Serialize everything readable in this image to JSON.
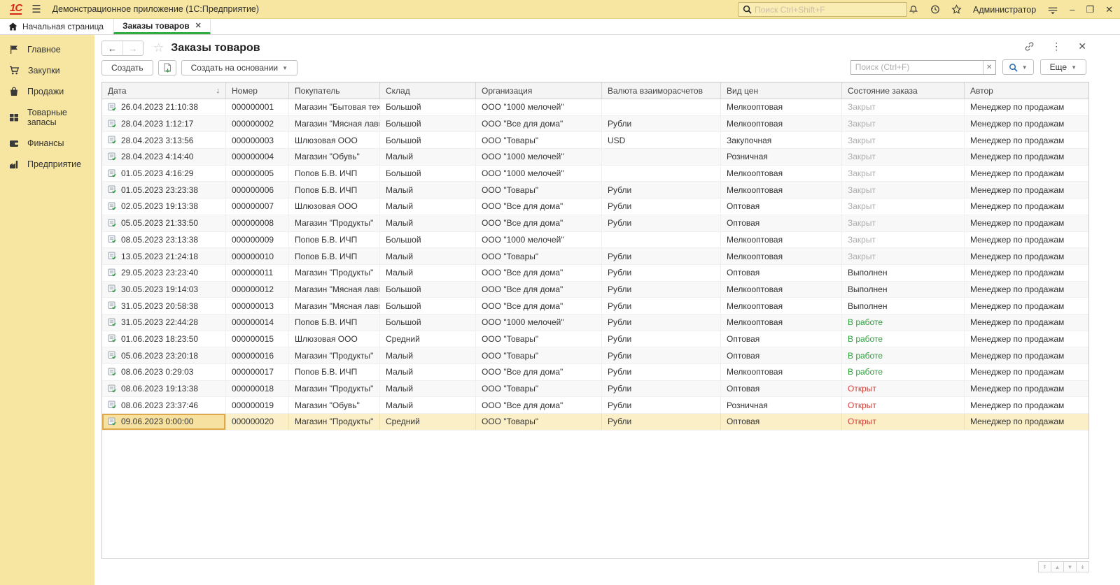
{
  "titlebar": {
    "app_title": "Демонстрационное приложение  (1С:Предприятие)",
    "logo": "1С",
    "search_placeholder": "Поиск Ctrl+Shift+F",
    "user": "Администратор"
  },
  "tabs": {
    "home_label": "Начальная страница",
    "active_tab_label": "Заказы товаров"
  },
  "sidebar": {
    "items": [
      {
        "label": "Главное",
        "icon": "flag-icon"
      },
      {
        "label": "Закупки",
        "icon": "cart-icon"
      },
      {
        "label": "Продажи",
        "icon": "bag-icon"
      },
      {
        "label": "Товарные запасы",
        "icon": "grid-icon"
      },
      {
        "label": "Финансы",
        "icon": "wallet-icon"
      },
      {
        "label": "Предприятие",
        "icon": "factory-icon"
      }
    ]
  },
  "page": {
    "title": "Заказы товаров",
    "toolbar": {
      "create_label": "Создать",
      "create_based_label": "Создать на основании",
      "search_placeholder": "Поиск (Ctrl+F)",
      "more_label": "Еще"
    }
  },
  "table": {
    "columns": [
      "Дата",
      "Номер",
      "Покупатель",
      "Склад",
      "Организация",
      "Валюта взаиморасчетов",
      "Вид цен",
      "Состояние заказа",
      "Автор"
    ],
    "sort_column": "Дата",
    "sort_direction": "asc",
    "selected_row_index": 19,
    "rows": [
      {
        "date": "26.04.2023 21:10:38",
        "number": "000000001",
        "customer": "Магазин \"Бытовая тех...",
        "warehouse": "Большой",
        "org": "ООО \"1000 мелочей\"",
        "currency": "",
        "price_type": "Мелкооптовая",
        "status": "Закрыт",
        "status_state": "closed",
        "author": "Менеджер по продажам"
      },
      {
        "date": "28.04.2023 1:12:17",
        "number": "000000002",
        "customer": "Магазин \"Мясная лавка\"",
        "warehouse": "Большой",
        "org": "ООО \"Все для дома\"",
        "currency": "Рубли",
        "price_type": "Мелкооптовая",
        "status": "Закрыт",
        "status_state": "closed",
        "author": "Менеджер по продажам"
      },
      {
        "date": "28.04.2023 3:13:56",
        "number": "000000003",
        "customer": "Шлюзовая ООО",
        "warehouse": "Большой",
        "org": "ООО \"Товары\"",
        "currency": "USD",
        "price_type": "Закупочная",
        "status": "Закрыт",
        "status_state": "closed",
        "author": "Менеджер по продажам"
      },
      {
        "date": "28.04.2023 4:14:40",
        "number": "000000004",
        "customer": "Магазин \"Обувь\"",
        "warehouse": "Малый",
        "org": "ООО \"1000 мелочей\"",
        "currency": "",
        "price_type": "Розничная",
        "status": "Закрыт",
        "status_state": "closed",
        "author": "Менеджер по продажам"
      },
      {
        "date": "01.05.2023 4:16:29",
        "number": "000000005",
        "customer": "Попов Б.В. ИЧП",
        "warehouse": "Большой",
        "org": "ООО \"1000 мелочей\"",
        "currency": "",
        "price_type": "Мелкооптовая",
        "status": "Закрыт",
        "status_state": "closed",
        "author": "Менеджер по продажам"
      },
      {
        "date": "01.05.2023 23:23:38",
        "number": "000000006",
        "customer": "Попов Б.В. ИЧП",
        "warehouse": "Малый",
        "org": "ООО \"Товары\"",
        "currency": "Рубли",
        "price_type": "Мелкооптовая",
        "status": "Закрыт",
        "status_state": "closed",
        "author": "Менеджер по продажам"
      },
      {
        "date": "02.05.2023 19:13:38",
        "number": "000000007",
        "customer": "Шлюзовая ООО",
        "warehouse": "Малый",
        "org": "ООО \"Все для дома\"",
        "currency": "Рубли",
        "price_type": "Оптовая",
        "status": "Закрыт",
        "status_state": "closed",
        "author": "Менеджер по продажам"
      },
      {
        "date": "05.05.2023 21:33:50",
        "number": "000000008",
        "customer": "Магазин \"Продукты\"",
        "warehouse": "Малый",
        "org": "ООО \"Все для дома\"",
        "currency": "Рубли",
        "price_type": "Оптовая",
        "status": "Закрыт",
        "status_state": "closed",
        "author": "Менеджер по продажам"
      },
      {
        "date": "08.05.2023 23:13:38",
        "number": "000000009",
        "customer": "Попов Б.В. ИЧП",
        "warehouse": "Большой",
        "org": "ООО \"1000 мелочей\"",
        "currency": "",
        "price_type": "Мелкооптовая",
        "status": "Закрыт",
        "status_state": "closed",
        "author": "Менеджер по продажам"
      },
      {
        "date": "13.05.2023 21:24:18",
        "number": "000000010",
        "customer": "Попов Б.В. ИЧП",
        "warehouse": "Малый",
        "org": "ООО \"Товары\"",
        "currency": "Рубли",
        "price_type": "Мелкооптовая",
        "status": "Закрыт",
        "status_state": "closed",
        "author": "Менеджер по продажам"
      },
      {
        "date": "29.05.2023 23:23:40",
        "number": "000000011",
        "customer": "Магазин \"Продукты\"",
        "warehouse": "Малый",
        "org": "ООО \"Все для дома\"",
        "currency": "Рубли",
        "price_type": "Оптовая",
        "status": "Выполнен",
        "status_state": "done",
        "author": "Менеджер по продажам"
      },
      {
        "date": "30.05.2023 19:14:03",
        "number": "000000012",
        "customer": "Магазин \"Мясная лавка\"",
        "warehouse": "Большой",
        "org": "ООО \"Все для дома\"",
        "currency": "Рубли",
        "price_type": "Мелкооптовая",
        "status": "Выполнен",
        "status_state": "done",
        "author": "Менеджер по продажам"
      },
      {
        "date": "31.05.2023 20:58:38",
        "number": "000000013",
        "customer": "Магазин \"Мясная лавка\"",
        "warehouse": "Большой",
        "org": "ООО \"Все для дома\"",
        "currency": "Рубли",
        "price_type": "Мелкооптовая",
        "status": "Выполнен",
        "status_state": "done",
        "author": "Менеджер по продажам"
      },
      {
        "date": "31.05.2023 22:44:28",
        "number": "000000014",
        "customer": "Попов Б.В. ИЧП",
        "warehouse": "Большой",
        "org": "ООО \"1000 мелочей\"",
        "currency": "Рубли",
        "price_type": "Мелкооптовая",
        "status": "В работе",
        "status_state": "in_progress",
        "author": "Менеджер по продажам"
      },
      {
        "date": "01.06.2023 18:23:50",
        "number": "000000015",
        "customer": "Шлюзовая ООО",
        "warehouse": "Средний",
        "org": "ООО \"Товары\"",
        "currency": "Рубли",
        "price_type": "Оптовая",
        "status": "В работе",
        "status_state": "in_progress",
        "author": "Менеджер по продажам"
      },
      {
        "date": "05.06.2023 23:20:18",
        "number": "000000016",
        "customer": "Магазин \"Продукты\"",
        "warehouse": "Малый",
        "org": "ООО \"Товары\"",
        "currency": "Рубли",
        "price_type": "Оптовая",
        "status": "В работе",
        "status_state": "in_progress",
        "author": "Менеджер по продажам"
      },
      {
        "date": "08.06.2023 0:29:03",
        "number": "000000017",
        "customer": "Попов Б.В. ИЧП",
        "warehouse": "Малый",
        "org": "ООО \"Все для дома\"",
        "currency": "Рубли",
        "price_type": "Мелкооптовая",
        "status": "В работе",
        "status_state": "in_progress",
        "author": "Менеджер по продажам"
      },
      {
        "date": "08.06.2023 19:13:38",
        "number": "000000018",
        "customer": "Магазин \"Продукты\"",
        "warehouse": "Малый",
        "org": "ООО \"Товары\"",
        "currency": "Рубли",
        "price_type": "Оптовая",
        "status": "Открыт",
        "status_state": "open",
        "author": "Менеджер по продажам"
      },
      {
        "date": "08.06.2023 23:37:46",
        "number": "000000019",
        "customer": "Магазин \"Обувь\"",
        "warehouse": "Малый",
        "org": "ООО \"Все для дома\"",
        "currency": "Рубли",
        "price_type": "Розничная",
        "status": "Открыт",
        "status_state": "open",
        "author": "Менеджер по продажам"
      },
      {
        "date": "09.06.2023 0:00:00",
        "number": "000000020",
        "customer": "Магазин \"Продукты\"",
        "warehouse": "Средний",
        "org": "ООО \"Товары\"",
        "currency": "Рубли",
        "price_type": "Оптовая",
        "status": "Открыт",
        "status_state": "open",
        "author": "Менеджер по продажам"
      }
    ]
  },
  "colors": {
    "accent_yellow": "#F6E6A2",
    "brand_red": "#D6281A",
    "tab_active_green": "#2FAE3F",
    "selected_row_bg": "#FBEFC7",
    "selected_cell_border": "#DFA94A",
    "status": {
      "closed": "#ADADAD",
      "done": "#333333",
      "in_progress": "#2DA13C",
      "open": "#D2413A"
    }
  }
}
